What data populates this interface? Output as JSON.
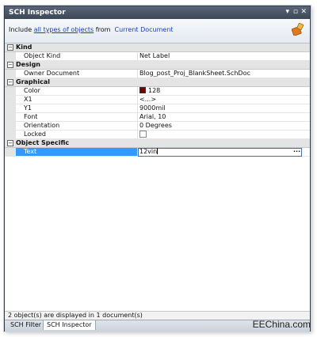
{
  "window": {
    "title": "SCH Inspector",
    "controls": {
      "pin": "▾",
      "restore": "▫",
      "close": "✕"
    }
  },
  "include_bar": {
    "prefix": "Include",
    "filter_link": "all types of objects",
    "from": "from",
    "scope_link": "Current Document",
    "icon": "brush-icon"
  },
  "categories": [
    {
      "label": "Kind",
      "rows": [
        {
          "name": "Object Kind",
          "value": "Net Label"
        }
      ]
    },
    {
      "label": "Design",
      "rows": [
        {
          "name": "Owner Document",
          "value": "Blog_post_Proj_BlankSheet.SchDoc"
        }
      ]
    },
    {
      "label": "Graphical",
      "rows": [
        {
          "name": "Color",
          "value": "128",
          "swatch": "#7a0000"
        },
        {
          "name": "X1",
          "value": "<...>"
        },
        {
          "name": "Y1",
          "value": "9000mil"
        },
        {
          "name": "Font",
          "value": "Arial, 10"
        },
        {
          "name": "Orientation",
          "value": "0 Degrees"
        },
        {
          "name": "Locked",
          "value": ""
        }
      ]
    },
    {
      "label": "Object Specific",
      "rows": [
        {
          "name": "Text",
          "value": "12vin",
          "ellipsis": "···"
        }
      ]
    }
  ],
  "toggle_symbol": "−",
  "status_text": "2 object(s) are displayed in 1 document(s)",
  "tabs": [
    "SCH Filter",
    "SCH Inspector"
  ],
  "active_tab": "SCH Inspector",
  "watermark": "EEChina.com",
  "colors": {
    "selection": "#3399ff",
    "title_bar": "#3b4657",
    "link": "#1a3fb8"
  }
}
